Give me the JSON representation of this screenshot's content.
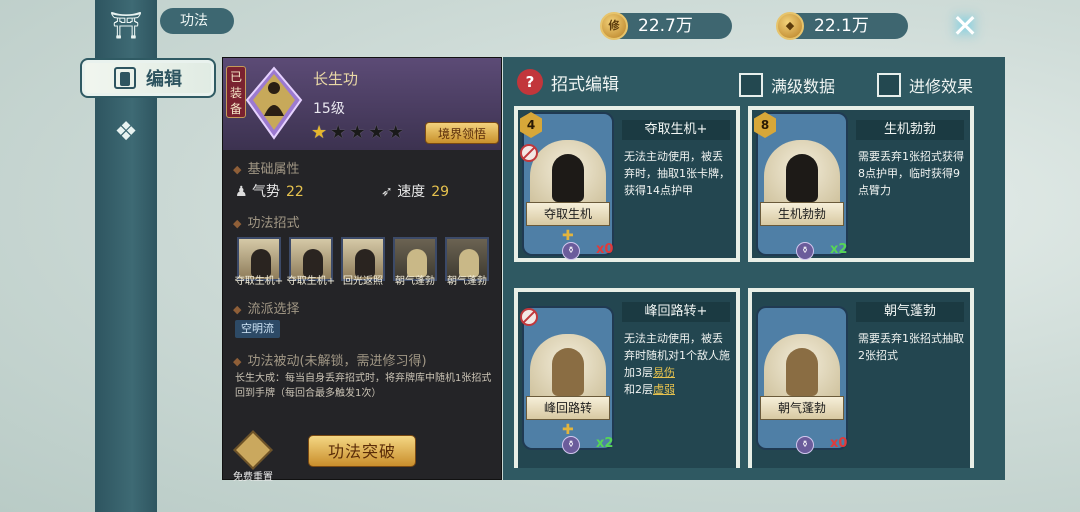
{
  "nav": {
    "tab_title": "功法",
    "edit_label": "编辑"
  },
  "currency": [
    {
      "icon": "修",
      "value": "22.7万"
    },
    {
      "icon": "coin",
      "value": "22.1万"
    }
  ],
  "gongfa": {
    "equipped": "已装备",
    "name": "长生功",
    "level": "15级",
    "stars_total": 5,
    "stars_lit": 1,
    "realm_button": "境界领悟",
    "basic_header": "基础属性",
    "attrs": [
      {
        "label": "气势",
        "value": "22"
      },
      {
        "label": "速度",
        "value": "29"
      }
    ],
    "moves_header": "功法招式",
    "moves": [
      {
        "label": "夺取生机+"
      },
      {
        "label": "夺取生机+"
      },
      {
        "label": "回光返照"
      },
      {
        "label": "朝气蓬勃"
      },
      {
        "label": "朝气蓬勃"
      }
    ],
    "school_header": "流派选择",
    "school_tag": "空明流",
    "passive_header": "功法被动(未解锁，需进修习得)",
    "passive_text": "长生大成：每当自身丢弃招式时，将弃牌库中随机1张招式回到手牌（每回合最多触发1次）",
    "reset_label": "免费重置",
    "break_button": "功法突破"
  },
  "editor": {
    "header": "招式编辑",
    "check_full": "满级数据",
    "check_advance": "进修效果",
    "cards": [
      {
        "name": "夺取生机+",
        "scroll": "夺取生机",
        "cost": "4",
        "banned": true,
        "count": "x0",
        "count_color": "#e23a3a",
        "desc": "无法主动使用，被丢弃时，抽取1张卡牌，获得14点护甲",
        "kw1": "",
        "kw2": ""
      },
      {
        "name": "生机勃勃",
        "scroll": "生机勃勃",
        "cost": "8",
        "banned": false,
        "count": "x2",
        "count_color": "#56d656",
        "desc": "需要丢弃1张招式获得8点护甲，临时获得9点臂力",
        "kw1": "",
        "kw2": ""
      },
      {
        "name": "峰回路转+",
        "scroll": "峰回路转",
        "cost": "",
        "banned": true,
        "count": "x2",
        "count_color": "#56d656",
        "desc": "无法主动使用，被丢弃时随机对1个敌人施加3层",
        "kw1": "易伤",
        "desc2": "和2层",
        "kw2": "虚弱"
      },
      {
        "name": "朝气蓬勃",
        "scroll": "朝气蓬勃",
        "cost": "",
        "banned": false,
        "count": "x0",
        "count_color": "#e23a3a",
        "desc": "需要丢弃1张招式抽取2张招式",
        "kw1": "",
        "kw2": ""
      }
    ]
  }
}
